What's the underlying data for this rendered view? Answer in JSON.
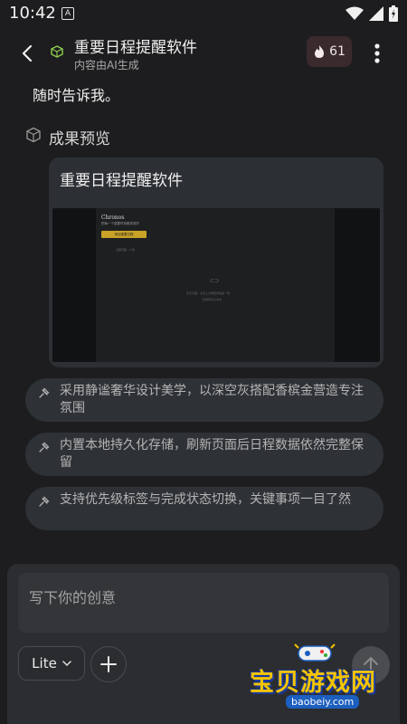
{
  "status_bar": {
    "time": "10:42",
    "notification_letter": "A"
  },
  "header": {
    "title": "重要日程提醒软件",
    "subtitle": "内容由AI生成",
    "credits": "61"
  },
  "conversation": {
    "intro_text": "随时告诉我。",
    "section_title": "成果预览",
    "preview": {
      "title": "重要日程提醒软件",
      "thumb_brand": "Chronos",
      "thumb_tagline": "把每一个重要时刻都安放好",
      "thumb_button": "添加重要日程",
      "thumb_list_label": "全部日程 · 0 项",
      "thumb_empty_icon": "⊂⊃",
      "thumb_empty_title": "暂无日程，点击上方按钮添加第一项",
      "thumb_empty_hint": "数据保存在本地"
    },
    "features": [
      "采用静谧奢华设计美学，以深空灰搭配香槟金营造专注氛围",
      "内置本地持久化存储，刷新页面后日程数据依然完整保留",
      "支持优先级标签与完成状态切换，关键事项一目了然"
    ]
  },
  "composer": {
    "placeholder": "写下你的创意",
    "mode_label": "Lite"
  },
  "watermark": {
    "brand": "宝贝游戏网",
    "url": "baobeiy.com"
  },
  "colors": {
    "background": "#1d1d1f",
    "credit_badge": "#3a2a2d",
    "accent_gold": "#c9a227"
  }
}
